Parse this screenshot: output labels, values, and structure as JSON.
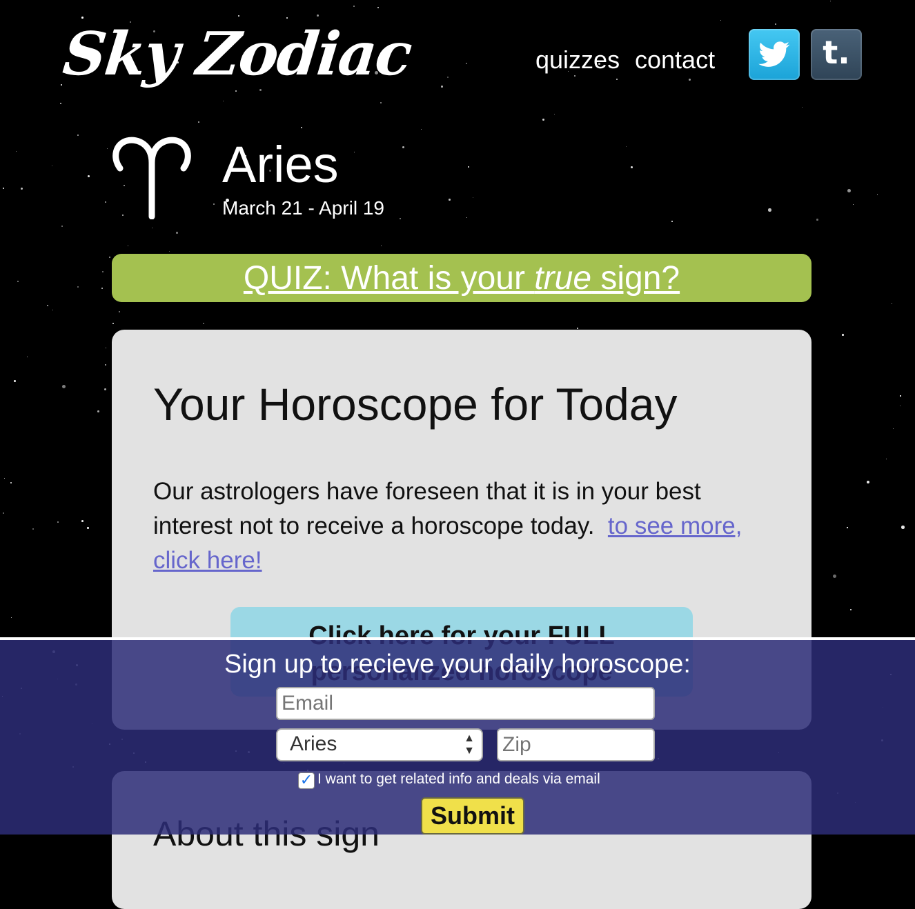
{
  "header": {
    "logo": "Sky Zodiac",
    "nav": {
      "quizzes": "quizzes",
      "contact": "contact"
    },
    "social": {
      "tumblr_glyph": "t."
    }
  },
  "sign": {
    "name": "Aries",
    "dates": "March 21 - April 19",
    "glyph": "aries-symbol-icon"
  },
  "quiz": {
    "prefix": "QUIZ: What is your ",
    "emphasis": "true",
    "suffix": " sign?"
  },
  "horoscope": {
    "title": "Your Horoscope for Today",
    "body": "Our astrologers have foreseen that it is in your best interest not to receive a horoscope today.",
    "link": "to see more, click here!",
    "full_button": "Click here for your FULL personalized horoscope"
  },
  "next_section": {
    "title": "About this sign"
  },
  "signup": {
    "title": "Sign up to recieve your daily horoscope:",
    "email_placeholder": "Email",
    "sign_selected": "Aries",
    "zip_placeholder": "Zip",
    "checkbox_label": "I want to get related info and deals via email",
    "checkbox_checked": true,
    "submit": "Submit"
  },
  "colors": {
    "quiz_bar": "#a4c150",
    "card": "#e2e2e2",
    "full_button": "#9bd8e5",
    "overlay": "#2d2d78",
    "submit": "#f0e04a",
    "twitter": "#29b6e8",
    "tumblr": "#34495e"
  }
}
